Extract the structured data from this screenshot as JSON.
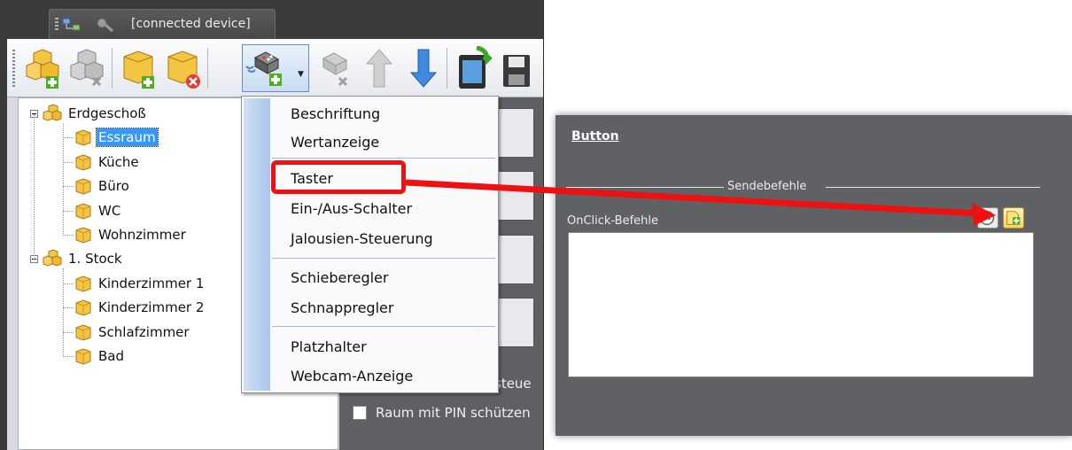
{
  "tab": {
    "label": "[connected device]"
  },
  "tree": {
    "floors": [
      {
        "label": "Erdgeschoß",
        "rooms": [
          "Essraum",
          "Küche",
          "Büro",
          "WC",
          "Wohnzimmer"
        ]
      },
      {
        "label": "1. Stock",
        "rooms": [
          "Kinderzimmer 1",
          "Kinderzimmer 2",
          "Schlafzimmer",
          "Bad"
        ]
      }
    ],
    "selected_room": "Essraum"
  },
  "menu": {
    "items": [
      "Beschriftung",
      "Wertanzeige",
      "Taster",
      "Ein-/Aus-Schalter",
      "Jalousien-Steuerung",
      "Schieberegler",
      "Schnappregler",
      "Platzhalter",
      "Webcam-Anzeige"
    ],
    "highlighted": "Taster"
  },
  "panel": {
    "pin_label": "Raum mit PIN schützen",
    "partial_label": "steue"
  },
  "properties": {
    "title": "Button",
    "section_label": "Sendebefehle",
    "onclick_label": "OnClick-Befehle"
  },
  "icons": [
    "network-icon",
    "key-icon",
    "add-floor-icon",
    "delete-floor-icon",
    "add-room-icon",
    "delete-room-icon",
    "add-element-icon",
    "delete-element-icon",
    "move-up-icon",
    "move-down-icon",
    "upload-device-icon",
    "save-icon",
    "timer-icon",
    "add-command-icon"
  ],
  "colors": {
    "highlight": "#ee1111",
    "selection": "#3399ff",
    "panel": "#606164"
  }
}
